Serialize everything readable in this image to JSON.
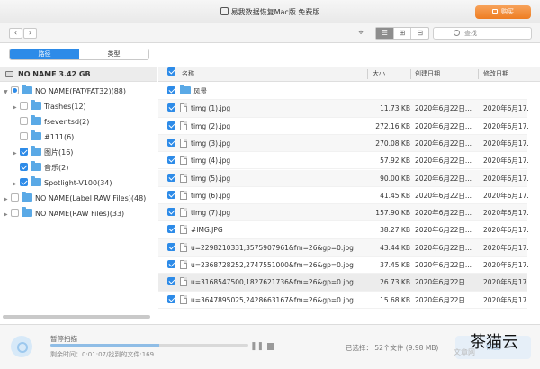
{
  "window": {
    "title": "易我数据恢复Mac版 免费版",
    "buy_label": "购买"
  },
  "toolbar": {
    "back_label": "‹",
    "forward_label": "›",
    "filter_icon": "⌖",
    "view_buttons": [
      "☰",
      "⊞",
      "⊟"
    ],
    "search_placeholder": "查找"
  },
  "sidebar": {
    "tabs": [
      "路径",
      "类型"
    ],
    "drive_label": "NO NAME 3.42 GB",
    "tree": [
      {
        "label": "NO NAME(FAT/FAT32)(88)",
        "check": "partial"
      },
      {
        "label": "Trashes(12)",
        "check": "off"
      },
      {
        "label": "fseventsd(2)",
        "check": "off"
      },
      {
        "label": "#111(6)",
        "check": "off"
      },
      {
        "label": "图片(16)",
        "check": "on"
      },
      {
        "label": "音乐(2)",
        "check": "on"
      },
      {
        "label": "Spotlight-V100(34)",
        "check": "on"
      },
      {
        "label": "NO NAME(Label RAW Files)(48)",
        "check": "off"
      },
      {
        "label": "NO NAME(RAW Files)(33)",
        "check": "off"
      }
    ]
  },
  "file_list": {
    "headers": {
      "name": "名称",
      "size": "大小",
      "created": "创建日期",
      "modified": "修改日期"
    },
    "rows": [
      {
        "name": "风景",
        "size": "",
        "created": "",
        "modified": "",
        "type": "folder"
      },
      {
        "name": "timg (1).jpg",
        "size": "11.73 KB",
        "created": "2020年6月22日...",
        "modified": "2020年6月17...",
        "type": "file"
      },
      {
        "name": "timg (2).jpg",
        "size": "272.16 KB",
        "created": "2020年6月22日...",
        "modified": "2020年6月17...",
        "type": "file"
      },
      {
        "name": "timg (3).jpg",
        "size": "270.08 KB",
        "created": "2020年6月22日...",
        "modified": "2020年6月17...",
        "type": "file"
      },
      {
        "name": "timg (4).jpg",
        "size": "57.92 KB",
        "created": "2020年6月22日...",
        "modified": "2020年6月17...",
        "type": "file"
      },
      {
        "name": "timg (5).jpg",
        "size": "90.00 KB",
        "created": "2020年6月22日...",
        "modified": "2020年6月17...",
        "type": "file"
      },
      {
        "name": "timg (6).jpg",
        "size": "41.45 KB",
        "created": "2020年6月22日...",
        "modified": "2020年6月17...",
        "type": "file"
      },
      {
        "name": "timg (7).jpg",
        "size": "157.90 KB",
        "created": "2020年6月22日...",
        "modified": "2020年6月17...",
        "type": "file"
      },
      {
        "name": "#IMG.JPG",
        "size": "38.27 KB",
        "created": "2020年6月22日...",
        "modified": "2020年6月17...",
        "type": "file"
      },
      {
        "name": "u=2298210331,3575907961&fm=26&gp=0.jpg",
        "size": "43.44 KB",
        "created": "2020年6月22日...",
        "modified": "2020年6月17...",
        "type": "file"
      },
      {
        "name": "u=2368728252,2747551000&fm=26&gp=0.jpg",
        "size": "37.45 KB",
        "created": "2020年6月22日...",
        "modified": "2020年6月17...",
        "type": "file"
      },
      {
        "name": "u=3168547500,1827621736&fm=26&gp=0.jpg",
        "size": "26.73 KB",
        "created": "2020年6月22日...",
        "modified": "2020年6月17...",
        "type": "file"
      },
      {
        "name": "u=3647895025,2428663167&fm=26&gp=0.jpg",
        "size": "15.68 KB",
        "created": "2020年6月22日...",
        "modified": "2020年6月17...",
        "type": "file"
      }
    ]
  },
  "status": {
    "scan_title": "暂停扫描",
    "scan_info": "剩余时间：0:01:07/找到的文件:169",
    "progress": 0.55,
    "pause_icon": "❚❚",
    "selected_text": "已选择：  52个文件 (9.98 MB)",
    "recover_label": "恢复"
  },
  "watermark": {
    "text": "茶猫云",
    "sub": "文章网"
  },
  "colors": {
    "accent": "#2d8be8",
    "buy": "#ee7d22"
  }
}
